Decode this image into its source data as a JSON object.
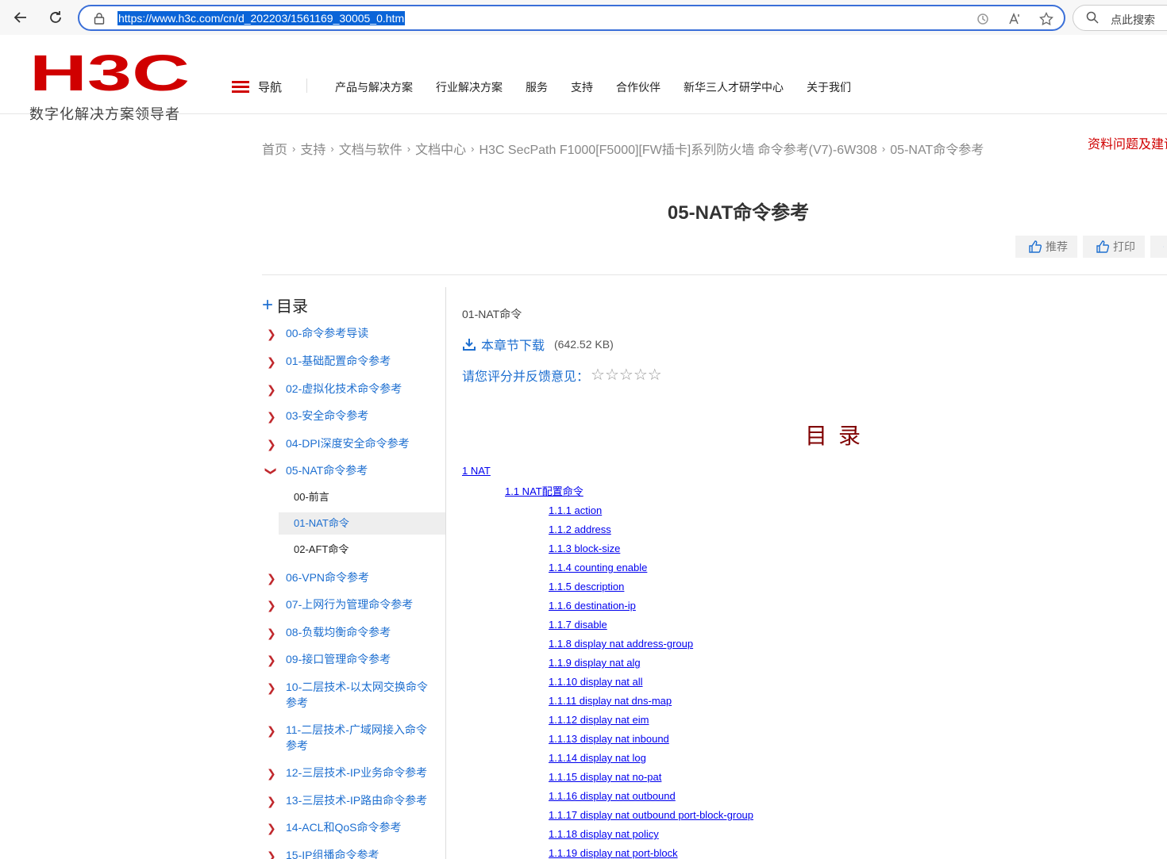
{
  "browser": {
    "url": "https://www.h3c.com/cn/d_202203/1561169_30005_0.htm",
    "search_placeholder": "点此搜索"
  },
  "header": {
    "logo_text": "H3C",
    "slogan": "数字化解决方案领导者",
    "nav_label": "导航",
    "nav_items": [
      "产品与解决方案",
      "行业解决方案",
      "服务",
      "支持",
      "合作伙伴",
      "新华三人才研学中心",
      "关于我们"
    ]
  },
  "breadcrumb": [
    "首页",
    "支持",
    "文档与软件",
    "文档中心",
    "H3C SecPath F1000[F5000][FW插卡]系列防火墙 命令参考(V7)-6W308",
    "05-NAT命令参考"
  ],
  "feedback_link": "资料问题及建议",
  "page_title": "05-NAT命令参考",
  "actions": {
    "recommend": "推荐",
    "print": "打印"
  },
  "sidebar": {
    "heading": "目录",
    "items": [
      {
        "label": "00-命令参考导读"
      },
      {
        "label": "01-基础配置命令参考"
      },
      {
        "label": "02-虚拟化技术命令参考"
      },
      {
        "label": "03-安全命令参考"
      },
      {
        "label": "04-DPI深度安全命令参考"
      },
      {
        "label": "05-NAT命令参考"
      },
      {
        "label": "06-VPN命令参考"
      },
      {
        "label": "07-上网行为管理命令参考"
      },
      {
        "label": "08-负载均衡命令参考"
      },
      {
        "label": "09-接口管理命令参考"
      },
      {
        "label": "10-二层技术-以太网交换命令参考"
      },
      {
        "label": "11-二层技术-广域网接入命令参考"
      },
      {
        "label": "12-三层技术-IP业务命令参考"
      },
      {
        "label": "13-三层技术-IP路由命令参考"
      },
      {
        "label": "14-ACL和QoS命令参考"
      },
      {
        "label": "15-IP组播命令参考"
      }
    ],
    "subitems": [
      {
        "label": "00-前言"
      },
      {
        "label": "01-NAT命令"
      },
      {
        "label": "02-AFT命令"
      }
    ]
  },
  "content": {
    "section_name": "01-NAT命令",
    "download_label": "本章节下载",
    "download_size": "(642.52 KB)",
    "rating_label": "请您评分并反馈意见：",
    "doc_toc_title": "目录",
    "toc": [
      {
        "text": "1 NAT",
        "level": 0
      },
      {
        "text": "1.1 NAT配置命令",
        "level": 1
      },
      {
        "text": "1.1.1 action",
        "level": 2
      },
      {
        "text": "1.1.2 address",
        "level": 2
      },
      {
        "text": "1.1.3 block-size",
        "level": 2
      },
      {
        "text": "1.1.4 counting enable",
        "level": 2
      },
      {
        "text": "1.1.5 description",
        "level": 2
      },
      {
        "text": "1.1.6 destination-ip",
        "level": 2
      },
      {
        "text": "1.1.7 disable",
        "level": 2
      },
      {
        "text": "1.1.8 display nat address-group",
        "level": 2
      },
      {
        "text": "1.1.9 display nat alg",
        "level": 2
      },
      {
        "text": "1.1.10 display nat all",
        "level": 2
      },
      {
        "text": "1.1.11 display nat dns-map",
        "level": 2
      },
      {
        "text": "1.1.12 display nat eim",
        "level": 2
      },
      {
        "text": "1.1.13 display nat inbound",
        "level": 2
      },
      {
        "text": "1.1.14 display nat log",
        "level": 2
      },
      {
        "text": "1.1.15 display nat no-pat",
        "level": 2
      },
      {
        "text": "1.1.16 display nat outbound",
        "level": 2
      },
      {
        "text": "1.1.17 display nat outbound port-block-group",
        "level": 2
      },
      {
        "text": "1.1.18 display nat policy",
        "level": 2
      },
      {
        "text": "1.1.19 display nat port-block",
        "level": 2
      }
    ]
  },
  "colors": {
    "brand_red": "#d00000",
    "link_blue": "#1e6fd0",
    "toc_title": "#800000"
  }
}
